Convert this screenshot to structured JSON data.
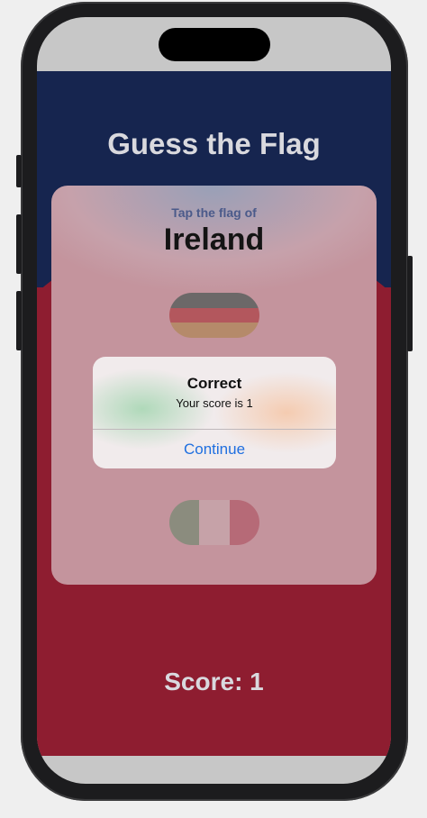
{
  "app": {
    "title": "Guess the Flag",
    "prompt": "Tap the flag of",
    "country": "Ireland",
    "score_label": "Score: 1"
  },
  "flags": [
    {
      "name": "Germany",
      "colors": [
        "#000000",
        "#dd0000",
        "#ffce00"
      ]
    },
    {
      "name": "Ireland",
      "colors": [
        "#169b62",
        "#ffffff",
        "#ff883e"
      ]
    }
  ],
  "alert": {
    "title": "Correct",
    "message": "Your score is 1",
    "button_label": "Continue",
    "button_color": "#1f6fe0"
  },
  "colors": {
    "navy": "#16254f",
    "red": "#8e1d30"
  }
}
